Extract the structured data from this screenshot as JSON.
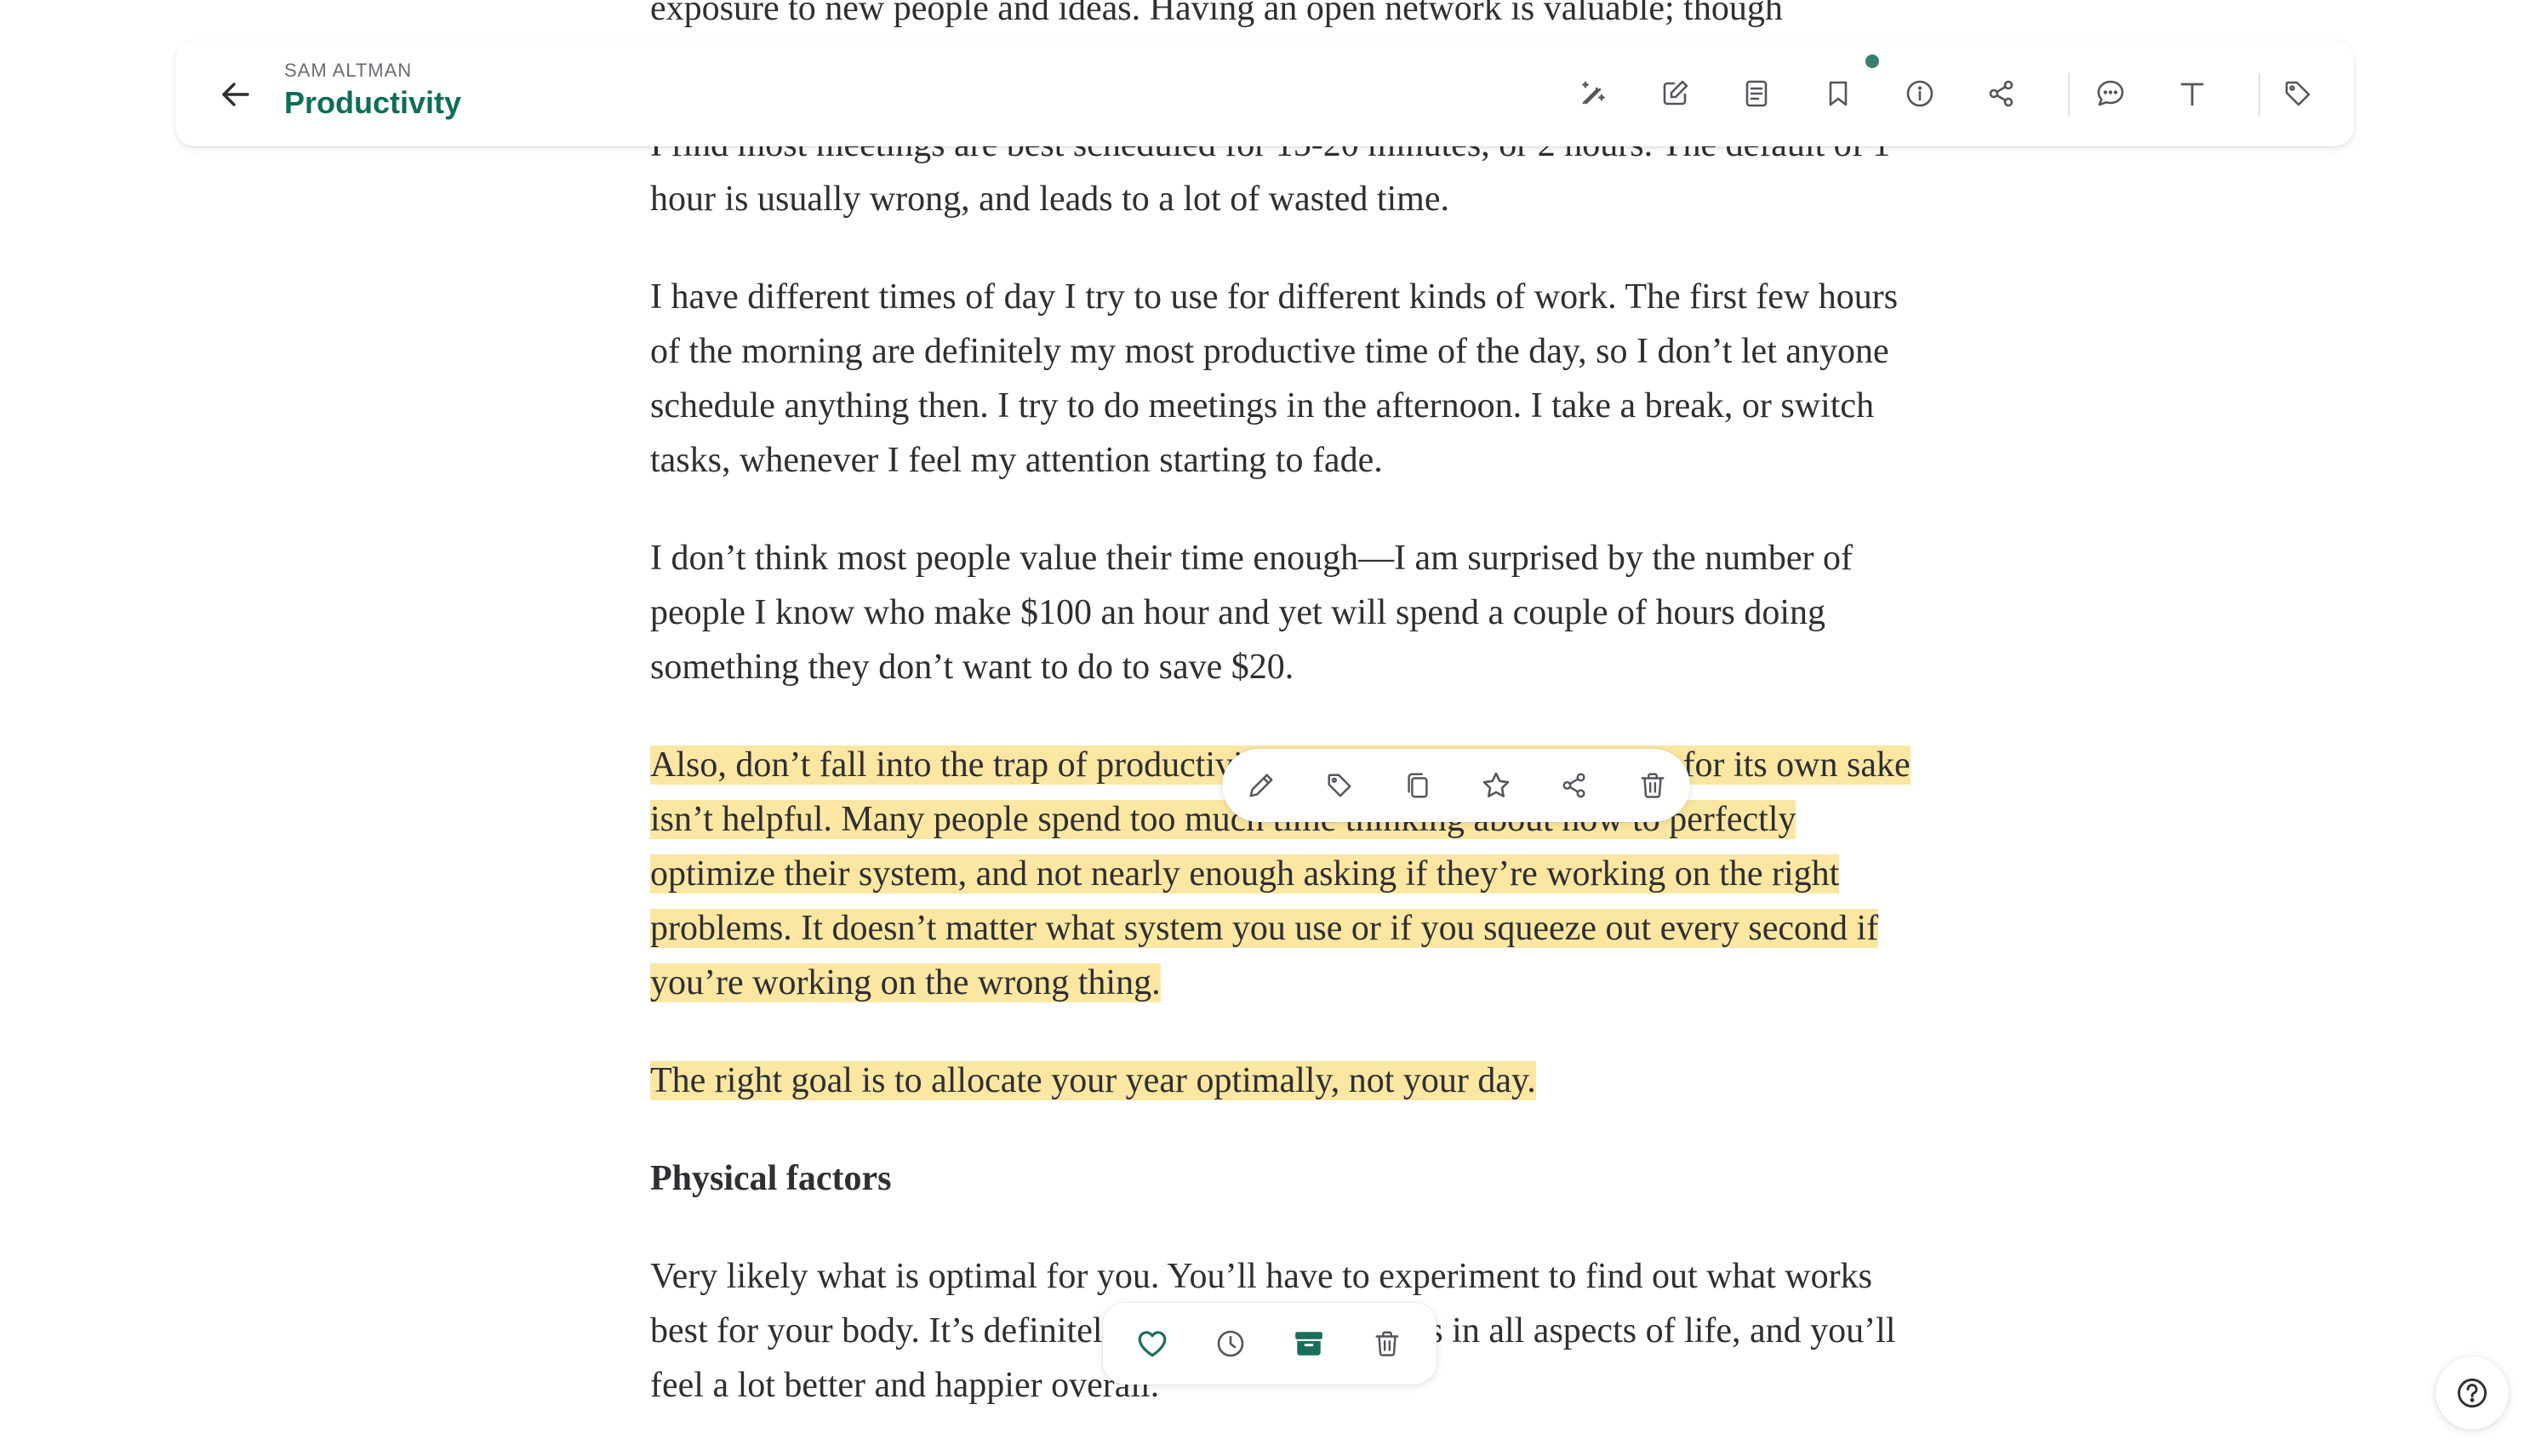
{
  "header": {
    "author": "SAM ALTMAN",
    "title": "Productivity",
    "icons": [
      "magic-wand-icon",
      "edit-icon",
      "notebook-icon",
      "bookmark-icon",
      "info-icon",
      "share-icon",
      "comment-icon",
      "text-format-icon",
      "tag-icon"
    ],
    "accent_color": "#0f6e5a"
  },
  "article": {
    "paragraphs": [
      "exposure to new people and ideas.  Having an open network is valuable; though",
      "I find most meetings are best scheduled for 15-20 minutes, or 2 hours.  The default of 1 hour is usually wrong, and leads to a lot of wasted time.",
      "I have different times of day I try to use for different kinds of work.  The first few hours of the morning are definitely my most productive time of the day, so I don’t let anyone schedule anything then.  I try to do meetings in the afternoon.  I take a break, or switch tasks, whenever I feel my attention starting to fade.",
      "I don’t think most people value their time enough—I am surprised by the number of people I know who make $100 an hour and yet will spend a couple of hours doing something they don’t want to do to save $20."
    ],
    "highlighted_paragraphs": [
      "Also, don’t fall into the trap of productivity porn—chasing productivity for its own sake isn’t helpful.  Many people spend too much time thinking about how to perfectly optimize their system, and not nearly enough asking if they’re working on the right problems.  It doesn’t matter what system you use or if you squeeze out every second if you’re working on the wrong thing.",
      "The right goal is to allocate your year optimally, not your day."
    ],
    "section_heading": "Physical factors",
    "last_paragraph_start": "Very likely what is optimal fo",
    "last_paragraph_rest": "r you.  You’ll have to experiment to find out what works best for your body.  It’s definitely worth doing—it helps in all aspects of life, and you’ll feel a lot better and happier overall.",
    "highlight_color": "#fbe7a1"
  },
  "highlight_toolbar": {
    "icons": [
      "pencil-icon",
      "tag-icon",
      "copy-icon",
      "star-icon",
      "share-icon",
      "trash-icon"
    ]
  },
  "bottom_bar": {
    "icons": [
      "heart-icon",
      "clock-icon",
      "archive-icon",
      "trash-icon"
    ],
    "active_color": "#1b6e5c"
  },
  "help": {
    "icon": "help-icon"
  }
}
